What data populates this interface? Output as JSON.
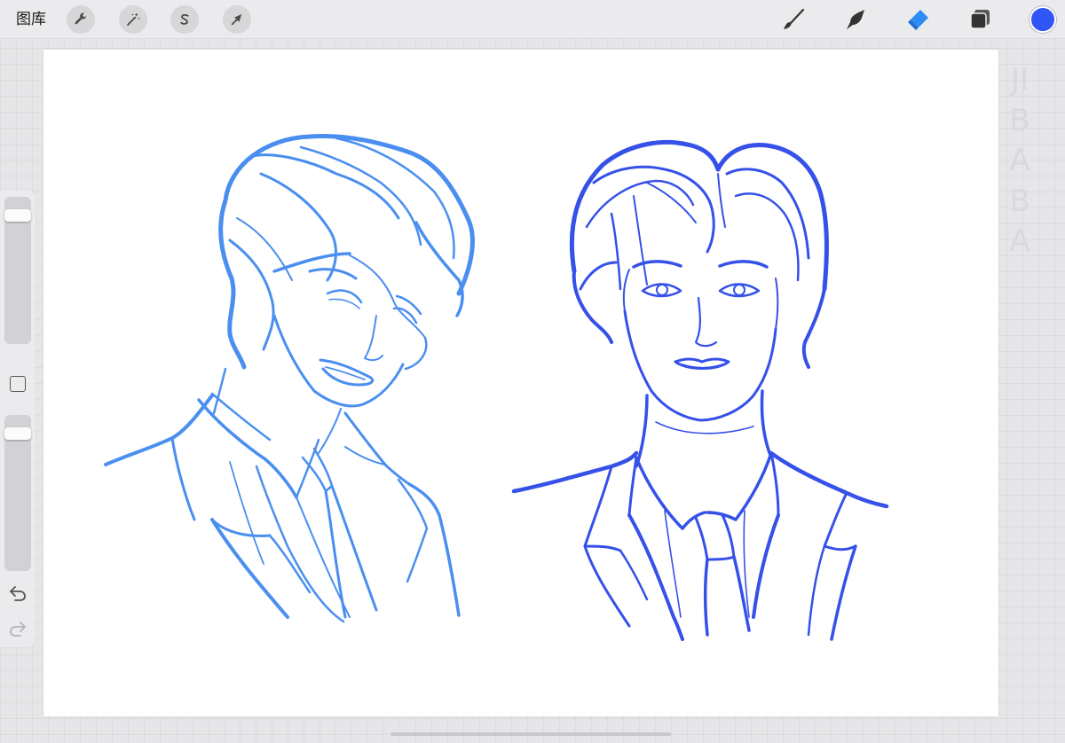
{
  "topbar": {
    "gallery_label": "图库",
    "left_tools": [
      {
        "name": "actions",
        "icon": "wrench-icon"
      },
      {
        "name": "adjustments",
        "icon": "magic-wand-icon"
      },
      {
        "name": "selection",
        "icon": "selection-s-icon"
      },
      {
        "name": "transform",
        "icon": "arrow-cursor-icon"
      }
    ],
    "right_tools": [
      {
        "name": "brush",
        "icon": "brush-icon"
      },
      {
        "name": "smudge",
        "icon": "smudge-finger-icon"
      },
      {
        "name": "eraser",
        "icon": "eraser-icon",
        "active": true
      },
      {
        "name": "layers",
        "icon": "layers-icon"
      }
    ],
    "current_color": "#2f55f5"
  },
  "sidebar": {
    "brush_size_level": 0.04,
    "opacity_level": 0.04,
    "modify_icon": "square-icon",
    "undo_icon": "undo-arrow-icon",
    "redo_icon": "redo-arrow-icon"
  },
  "colors": {
    "left_sketch": "#4a8ff0",
    "right_sketch": "#3551e8",
    "active_tool": "#2e8df5"
  },
  "watermark": "JIBABA"
}
